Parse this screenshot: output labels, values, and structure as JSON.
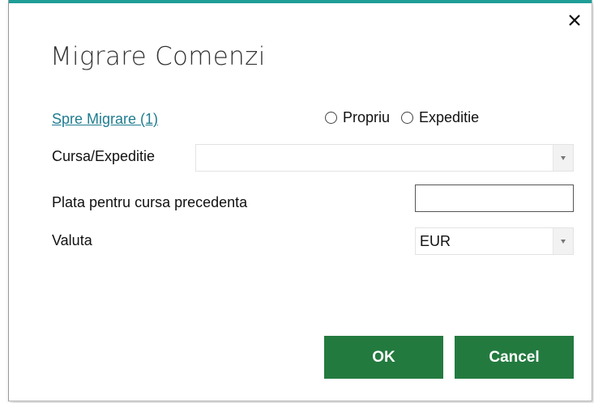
{
  "dialog": {
    "title": "Migrare Comenzi",
    "accent_color": "#1e9e97",
    "close_icon": "close-icon"
  },
  "migration_link": "Spre Migrare (1)",
  "radio_options": [
    {
      "label": "Propriu",
      "selected": false
    },
    {
      "label": "Expeditie",
      "selected": false
    }
  ],
  "fields": {
    "cursa_label": "Cursa/Expeditie",
    "cursa_value": "",
    "plata_label": "Plata pentru cursa precedenta",
    "plata_value": "",
    "valuta_label": "Valuta",
    "valuta_value": "EUR"
  },
  "buttons": {
    "ok": "OK",
    "cancel": "Cancel",
    "color": "#237a3f"
  }
}
